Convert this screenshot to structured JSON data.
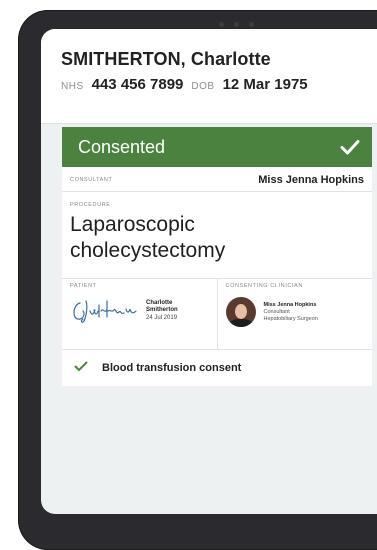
{
  "patient": {
    "name": "SMITHERTON, Charlotte",
    "nhs_label": "NHS",
    "nhs_number": "443 456 7899",
    "dob_label": "DOB",
    "dob": "12 Mar 1975"
  },
  "consent": {
    "status": "Consented",
    "status_color": "#4c8240",
    "consultant_label": "CONSULTANT",
    "consultant": "Miss Jenna Hopkins",
    "procedure_label": "PROCEDURE",
    "procedure": "Laparoscopic cholecystectomy",
    "patient_label": "PATIENT",
    "patient_sig_name_1": "Charlotte",
    "patient_sig_name_2": "Smitherton",
    "patient_sig_date": "24 Jul 2019",
    "clinician_label": "CONSENTING CLINICIAN",
    "clinician_name": "Miss Jenna Hopkins",
    "clinician_role": "Consultant",
    "clinician_specialty": "Hepatobiliary Surgeon",
    "extra_item": "Blood transfusion consent"
  },
  "icons": {
    "status": "check-icon",
    "extra_item": "check-icon"
  }
}
